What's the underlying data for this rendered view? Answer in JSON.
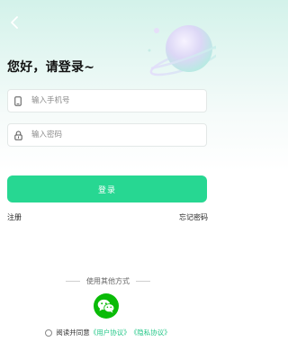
{
  "header": {
    "back_icon": "chevron-left-icon",
    "decoration": "planet-illustration"
  },
  "title": "您好，请登录~",
  "form": {
    "phone": {
      "placeholder": "输入手机号",
      "value": "",
      "icon": "phone-icon"
    },
    "password": {
      "placeholder": "输入密码",
      "value": "",
      "icon": "lock-icon"
    },
    "submit_label": "登录"
  },
  "links": {
    "register": "注册",
    "forgot_password": "忘记密码"
  },
  "other_login": {
    "label": "使用其他方式",
    "wechat_icon": "wechat-icon"
  },
  "agreement": {
    "prefix": "阅读并同意",
    "user_agreement": "《用户协议》",
    "privacy_policy": "《隐私协议》",
    "checked": false
  },
  "colors": {
    "primary": "#27d792",
    "wechat": "#09bb07",
    "link": "#22c787"
  }
}
